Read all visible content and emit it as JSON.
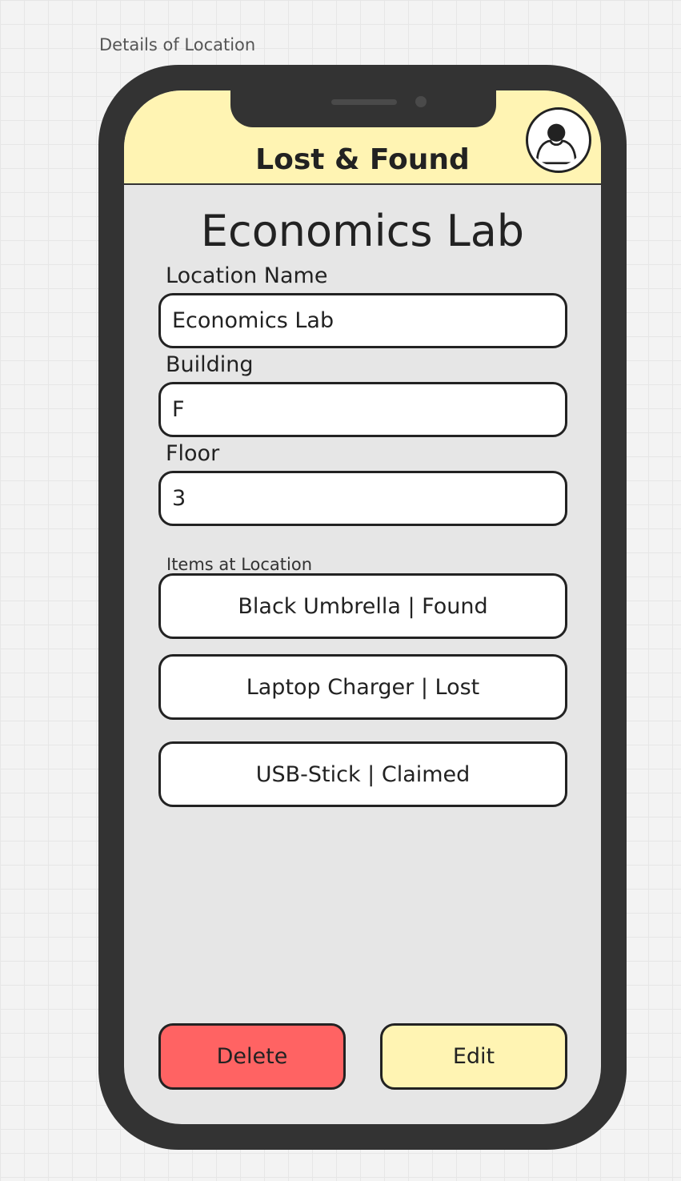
{
  "canvas": {
    "label": "Details of Location"
  },
  "app": {
    "title": "Lost & Found",
    "header_color": "#fff4b3"
  },
  "header": {
    "profile_icon": "user-profile-icon"
  },
  "location": {
    "title": "Economics Lab",
    "fields": {
      "name": {
        "label": "Location Name",
        "value": "Economics Lab"
      },
      "building": {
        "label": "Building",
        "value": "F"
      },
      "floor": {
        "label": "Floor",
        "value": "3"
      }
    }
  },
  "items": {
    "label": "Items at Location",
    "list": [
      {
        "label": "Black Umbrella | Found"
      },
      {
        "label": "Laptop Charger | Lost"
      },
      {
        "label": "USB-Stick | Claimed"
      }
    ]
  },
  "actions": {
    "delete_label": "Delete",
    "edit_label": "Edit",
    "delete_color": "#ff6363",
    "edit_color": "#fff4b3"
  }
}
